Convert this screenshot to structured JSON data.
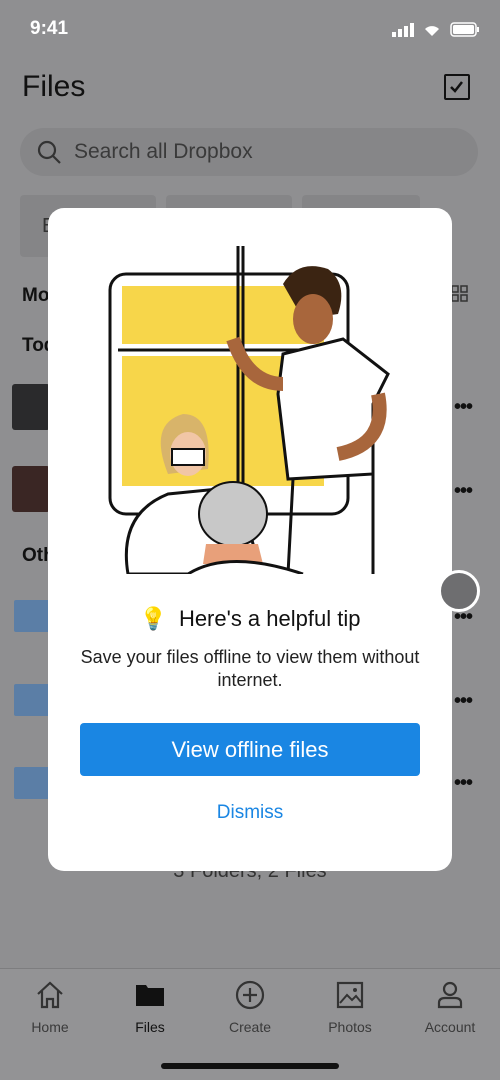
{
  "status_bar": {
    "time": "9:41"
  },
  "header": {
    "title": "Files",
    "search_placeholder": "Search all Dropbox"
  },
  "background": {
    "chip_partial": "E",
    "section_most": "Mo",
    "section_today": "Tod",
    "section_other": "Oth",
    "summary": "3 Folders, 2 Files"
  },
  "tip_modal": {
    "title": "Here's a helpful tip",
    "icon": "lightbulb-icon",
    "body": "Save your files offline to view them without internet.",
    "primary_button": "View offline files",
    "dismiss_button": "Dismiss"
  },
  "colors": {
    "accent": "#1a86e3",
    "illustration_yellow": "#f7d64a"
  },
  "tabbar": {
    "items": [
      {
        "label": "Home",
        "icon": "home-icon"
      },
      {
        "label": "Files",
        "icon": "folder-icon",
        "active": true
      },
      {
        "label": "Create",
        "icon": "plus-circle-icon"
      },
      {
        "label": "Photos",
        "icon": "photo-icon"
      },
      {
        "label": "Account",
        "icon": "person-icon"
      }
    ]
  }
}
